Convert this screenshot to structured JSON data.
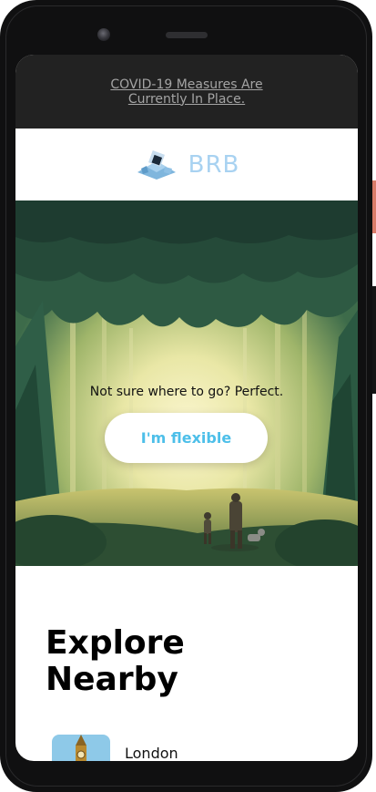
{
  "banner": {
    "text": "COVID-19 Measures Are Currently In Place."
  },
  "header": {
    "logo_text": "BRB"
  },
  "hero": {
    "tagline": "Not sure where to go? Perfect.",
    "button_label": "I'm flexible"
  },
  "explore": {
    "title": "Explore Nearby",
    "items": [
      {
        "label": "London",
        "icon": "big-ben-icon"
      }
    ]
  },
  "colors": {
    "banner_bg": "#222222",
    "accent": "#4dbfe9",
    "logo": "#a8d2f1"
  }
}
